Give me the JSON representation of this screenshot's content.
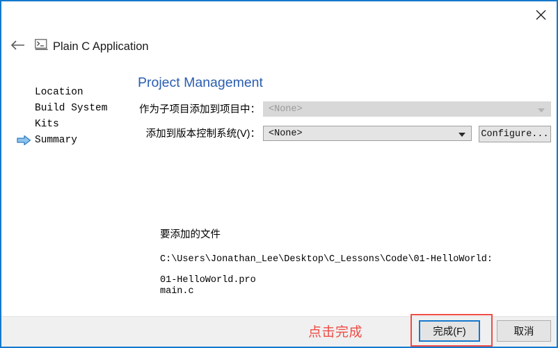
{
  "window": {
    "border_color": "#1478cd",
    "close_icon": "close-icon"
  },
  "header": {
    "back_icon": "back-arrow-icon",
    "app_icon": "console-application-icon",
    "title": "Plain C Application"
  },
  "steps": {
    "items": [
      {
        "label": "Location",
        "current": false
      },
      {
        "label": "Build System",
        "current": false
      },
      {
        "label": "Kits",
        "current": false
      },
      {
        "label": "Summary",
        "current": true
      }
    ],
    "current_marker_icon": "blue-arrow-icon",
    "marker_color": "#3d8fd4"
  },
  "panel": {
    "title": "Project Management",
    "title_color": "#2a5db0",
    "rows": [
      {
        "label": "作为子项目添加到项目中：",
        "value": "<None>",
        "enabled": false
      },
      {
        "label": "添加到版本控制系统(V)：",
        "value": "<None>",
        "enabled": true
      }
    ],
    "configure_label": "Configure..."
  },
  "files": {
    "heading": "要添加的文件",
    "path": "C:\\Users\\Jonathan_Lee\\Desktop\\C_Lessons\\Code\\01-HelloWorld:",
    "items": [
      "01-HelloWorld.pro",
      "main.c"
    ]
  },
  "footer": {
    "annotation": "点击完成",
    "annotation_color": "#ef4b45",
    "finish_label": "完成(F)",
    "cancel_label": "取消",
    "focus_color": "#1478cd"
  }
}
